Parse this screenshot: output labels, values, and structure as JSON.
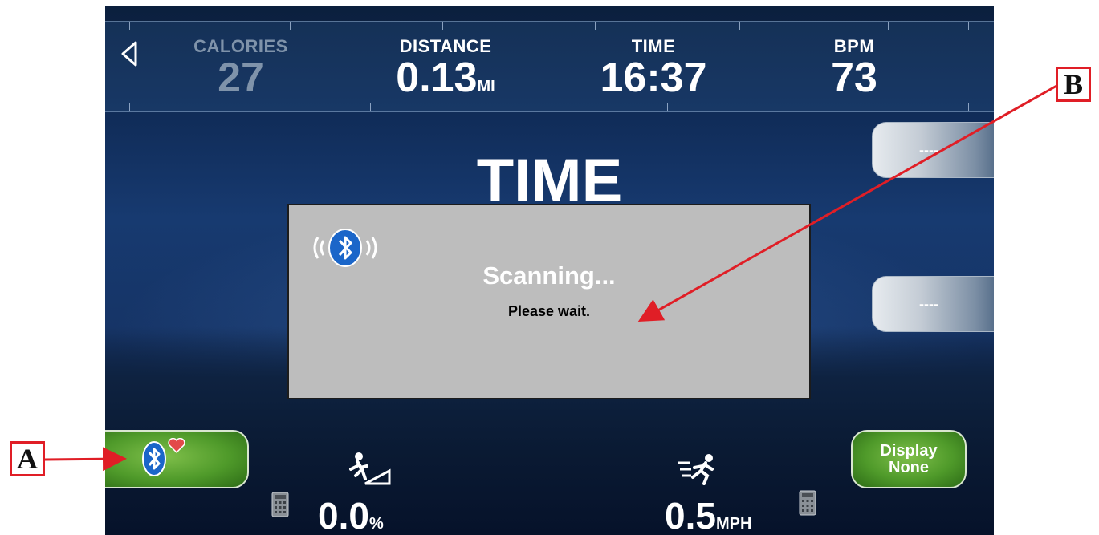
{
  "stats": {
    "calories": {
      "label": "CALORIES",
      "value": "27"
    },
    "distance": {
      "label": "DISTANCE",
      "value": "0.13",
      "unit": "MI"
    },
    "time": {
      "label": "TIME",
      "value": "16:37"
    },
    "bpm": {
      "label": "BPM",
      "value": "73"
    }
  },
  "main_title": "TIME",
  "side_buttons": {
    "top": "----",
    "middle": "----"
  },
  "dialog": {
    "title": "Scanning...",
    "message": "Please wait.",
    "icon": "bluetooth-icon"
  },
  "bottom": {
    "incline": {
      "value": "0.0",
      "unit": "%",
      "icon": "incline-walker-icon"
    },
    "speed": {
      "value": "0.5",
      "unit": "MPH",
      "icon": "runner-icon"
    },
    "display_button": {
      "line1": "Display",
      "line2": "None"
    },
    "bt_hr_button": {
      "icons": [
        "bluetooth-icon",
        "heart-icon"
      ]
    }
  },
  "callouts": {
    "a": "A",
    "b": "B"
  },
  "colors": {
    "callout_red": "#e01e26",
    "green_button": "#4f9a2a",
    "dialog_gray": "#bdbdbd"
  }
}
